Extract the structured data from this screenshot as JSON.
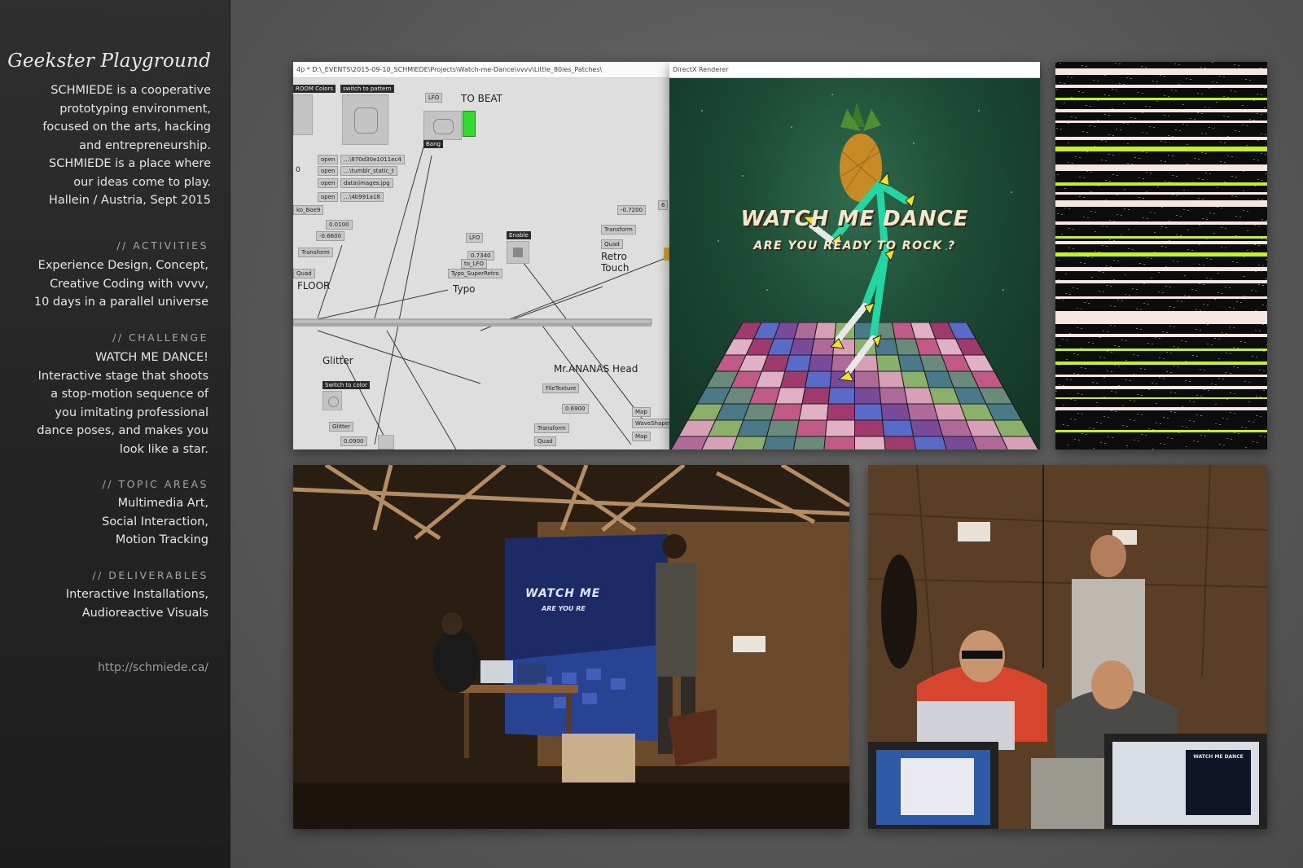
{
  "sidebar": {
    "title": "Geekster Playground",
    "intro_lines": [
      "SCHMIEDE  is a cooperative",
      "prototyping environment,",
      "focused on the arts, hacking",
      "and entrepreneurship.",
      "SCHMIEDE is a place where",
      "our ideas come to play.",
      "Hallein / Austria, Sept 2015"
    ],
    "sections": [
      {
        "heading": "// ACTIVITIES",
        "lines": [
          "Experience Design, Concept,",
          "Creative Coding with vvvv,",
          "10 days in a parallel universe"
        ]
      },
      {
        "heading": "// CHALLENGE",
        "lines": [
          "WATCH ME DANCE!",
          "Interactive stage that shoots",
          "a stop-motion sequence of",
          "you imitating professional",
          "dance poses, and makes you",
          "look like a star."
        ]
      },
      {
        "heading": "// TOPIC AREAS",
        "lines": [
          "Multimedia Art,",
          "Social Interaction,",
          "Motion Tracking"
        ]
      },
      {
        "heading": "// DELIVERABLES",
        "lines": [
          "Interactive Installations,",
          "Audioreactive Visuals"
        ]
      }
    ],
    "url": "http://schmiede.ca/"
  },
  "patch_editor": {
    "window_title": "4p * D:\\_EVENTS\\2015-09-10_SCHMIEDE\\Projects\\Watch-me-Dance\\vvvv\\Little_80ies_Patches\\",
    "labels": {
      "to_beat": "TO BEAT",
      "floor": "FLOOR",
      "typo": "Typo",
      "retro_touch_1": "Retro",
      "retro_touch_2": "Touch",
      "glitter": "Glitter",
      "mr_ananas": "Mr.ANANAS Head"
    },
    "nodes": {
      "room_colors": "ROOM Colors",
      "switch_pattern": "switch to pattern",
      "lfo_top": "LFO",
      "bang": "Bang",
      "open1": "open",
      "file1": "…\\870d30e1011ec4",
      "open2": "open",
      "file2": "…\\tumblr_static_t",
      "open3": "open",
      "file3": "data\\images.jpg",
      "open4": "open",
      "file4": "…\\4b991a18",
      "zero": "0",
      "boes": "ko_Boe9",
      "v0100": "0.0100",
      "vneg0660": "-0.6600",
      "transform1": "Transform",
      "quad1": "Quad",
      "lfo_mid": "LFO",
      "v7340": "0.7340",
      "to_lfo": "to_LFO",
      "typo_super": "Typo_SuperRetro",
      "enable": "Enable",
      "vneg7200": "-0.7200",
      "six": "6",
      "transform2": "Transform",
      "quad2": "Quad",
      "switch_color": "Switch to color",
      "glitter_node": "Glitter",
      "v0900": "0.0900",
      "filetexture": "FileTexture",
      "v6900": "0.6900",
      "transform3": "Transform",
      "quad3": "Quad",
      "map1": "Map",
      "waveshaper": "WaveShaper",
      "map2": "Map"
    }
  },
  "renderer": {
    "window_title": "DirectX Renderer",
    "headline": "WATCH ME DANCE",
    "subline": "ARE YOU READY TO ROCK ?"
  },
  "photos": {
    "left_screen_title": "WATCH ME",
    "left_screen_sub": "ARE YOU RE",
    "right_screen_title": "WATCH ME DANCE"
  },
  "colors": {
    "accent_lime": "#c6f21c",
    "stripe_cream": "#f5e6e0",
    "sidebar_bg": "#262626",
    "page_bg": "#5a5a5a"
  }
}
